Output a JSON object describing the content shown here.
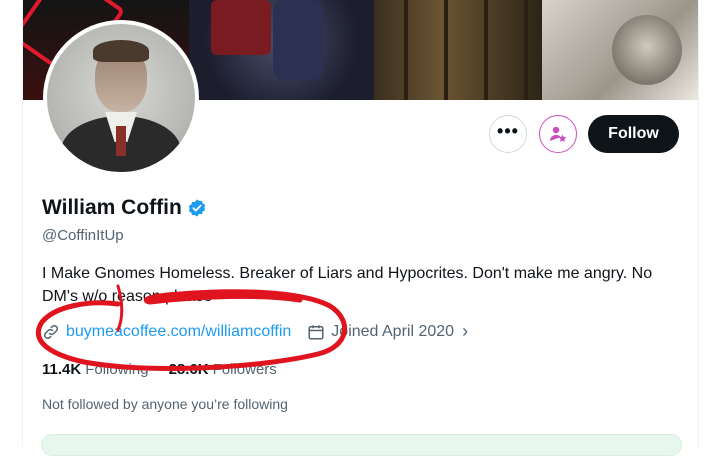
{
  "profile": {
    "name": "William Coffin",
    "handle": "@CoffinItUp",
    "bio": "I Make Gnomes Homeless. Breaker of Liars and Hypocrites. Don't make me angry. No DM's w/o reason please",
    "website": "buymeacoffee.com/williamcoffin",
    "joined": "Joined April 2020",
    "following_count": "11.4K",
    "following_label": "Following",
    "followers_count": "28.6K",
    "followers_label": "Followers",
    "not_followed_text": "Not followed by anyone you’re following"
  },
  "actions": {
    "more_label": "•••",
    "follow_label": "Follow"
  },
  "icons": {
    "more": "more-icon",
    "subscribe": "subscribe-star-icon",
    "verified": "verified-badge-icon",
    "link": "link-icon",
    "calendar": "calendar-icon",
    "chevron": "chevron-right-icon"
  },
  "colors": {
    "accent": "#1d9bf0",
    "subscribe_accent": "#c94fc1",
    "follow_bg": "#0f1419",
    "annotation": "#e0141e"
  }
}
